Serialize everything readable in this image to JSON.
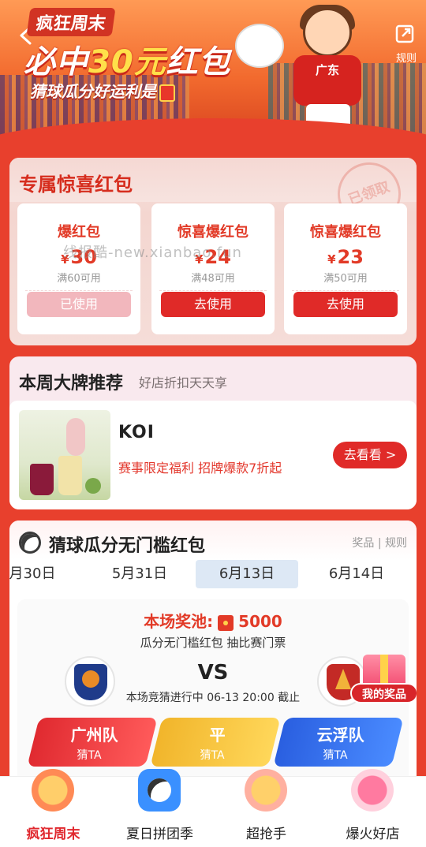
{
  "banner": {
    "back_icon": "arrow-left-icon",
    "tag": "疯狂周末",
    "headline_prefix": "必中",
    "headline_amount": "30元",
    "headline_suffix": "红包",
    "sub_headline": "猜球瓜分好运利是",
    "player_jersey": "广东",
    "rules_icon": "share-icon",
    "rules_label": "规则"
  },
  "packets": {
    "title": "专属惊喜红包",
    "stamp": "已领取",
    "watermark": "线报酷-new.xianbao.fun",
    "items": [
      {
        "name": "爆红包",
        "amount": "30",
        "currency": "¥",
        "condition": "满60可用",
        "button": "已使用",
        "used": true
      },
      {
        "name": "惊喜爆红包",
        "amount": "24",
        "currency": "¥",
        "condition": "满48可用",
        "button": "去使用",
        "used": false
      },
      {
        "name": "惊喜爆红包",
        "amount": "23",
        "currency": "¥",
        "condition": "满50可用",
        "button": "去使用",
        "used": false
      }
    ]
  },
  "brand": {
    "title": "本周大牌推荐",
    "subtitle": "好店折扣天天享",
    "name": "KOI",
    "desc": "赛事限定福利 招牌爆款7折起",
    "button": "去看看 >"
  },
  "guess": {
    "title": "猜球瓜分无门槛红包",
    "links": "奖品 | 规则",
    "dates": [
      "月30日",
      "5月31日",
      "6月13日",
      "6月14日"
    ],
    "active_date_index": 2,
    "pool_label": "本场奖池:",
    "pool_value": "5000",
    "pool_sub": "瓜分无门槛红包 抽比赛门票",
    "vs": "VS",
    "deadline": "本场竞猜进行中 06-13 20:00 截止",
    "my_prize": "我的奖品",
    "options": [
      {
        "team": "广州队",
        "action": "猜TA"
      },
      {
        "team": "平",
        "action": "猜TA"
      },
      {
        "team": "云浮队",
        "action": "猜TA"
      }
    ]
  },
  "nav": {
    "items": [
      {
        "label": "疯狂周末",
        "icon": "burger-icon",
        "active": true
      },
      {
        "label": "夏日拼团季",
        "icon": "football-icon",
        "active": false
      },
      {
        "label": "超抢手",
        "icon": "hand-icon",
        "active": false
      },
      {
        "label": "爆火好店",
        "icon": "heart-icon",
        "active": false
      }
    ]
  },
  "colors": {
    "accent_red": "#e02a28",
    "bg_red": "#e8402d",
    "gold": "#ffe04a"
  }
}
